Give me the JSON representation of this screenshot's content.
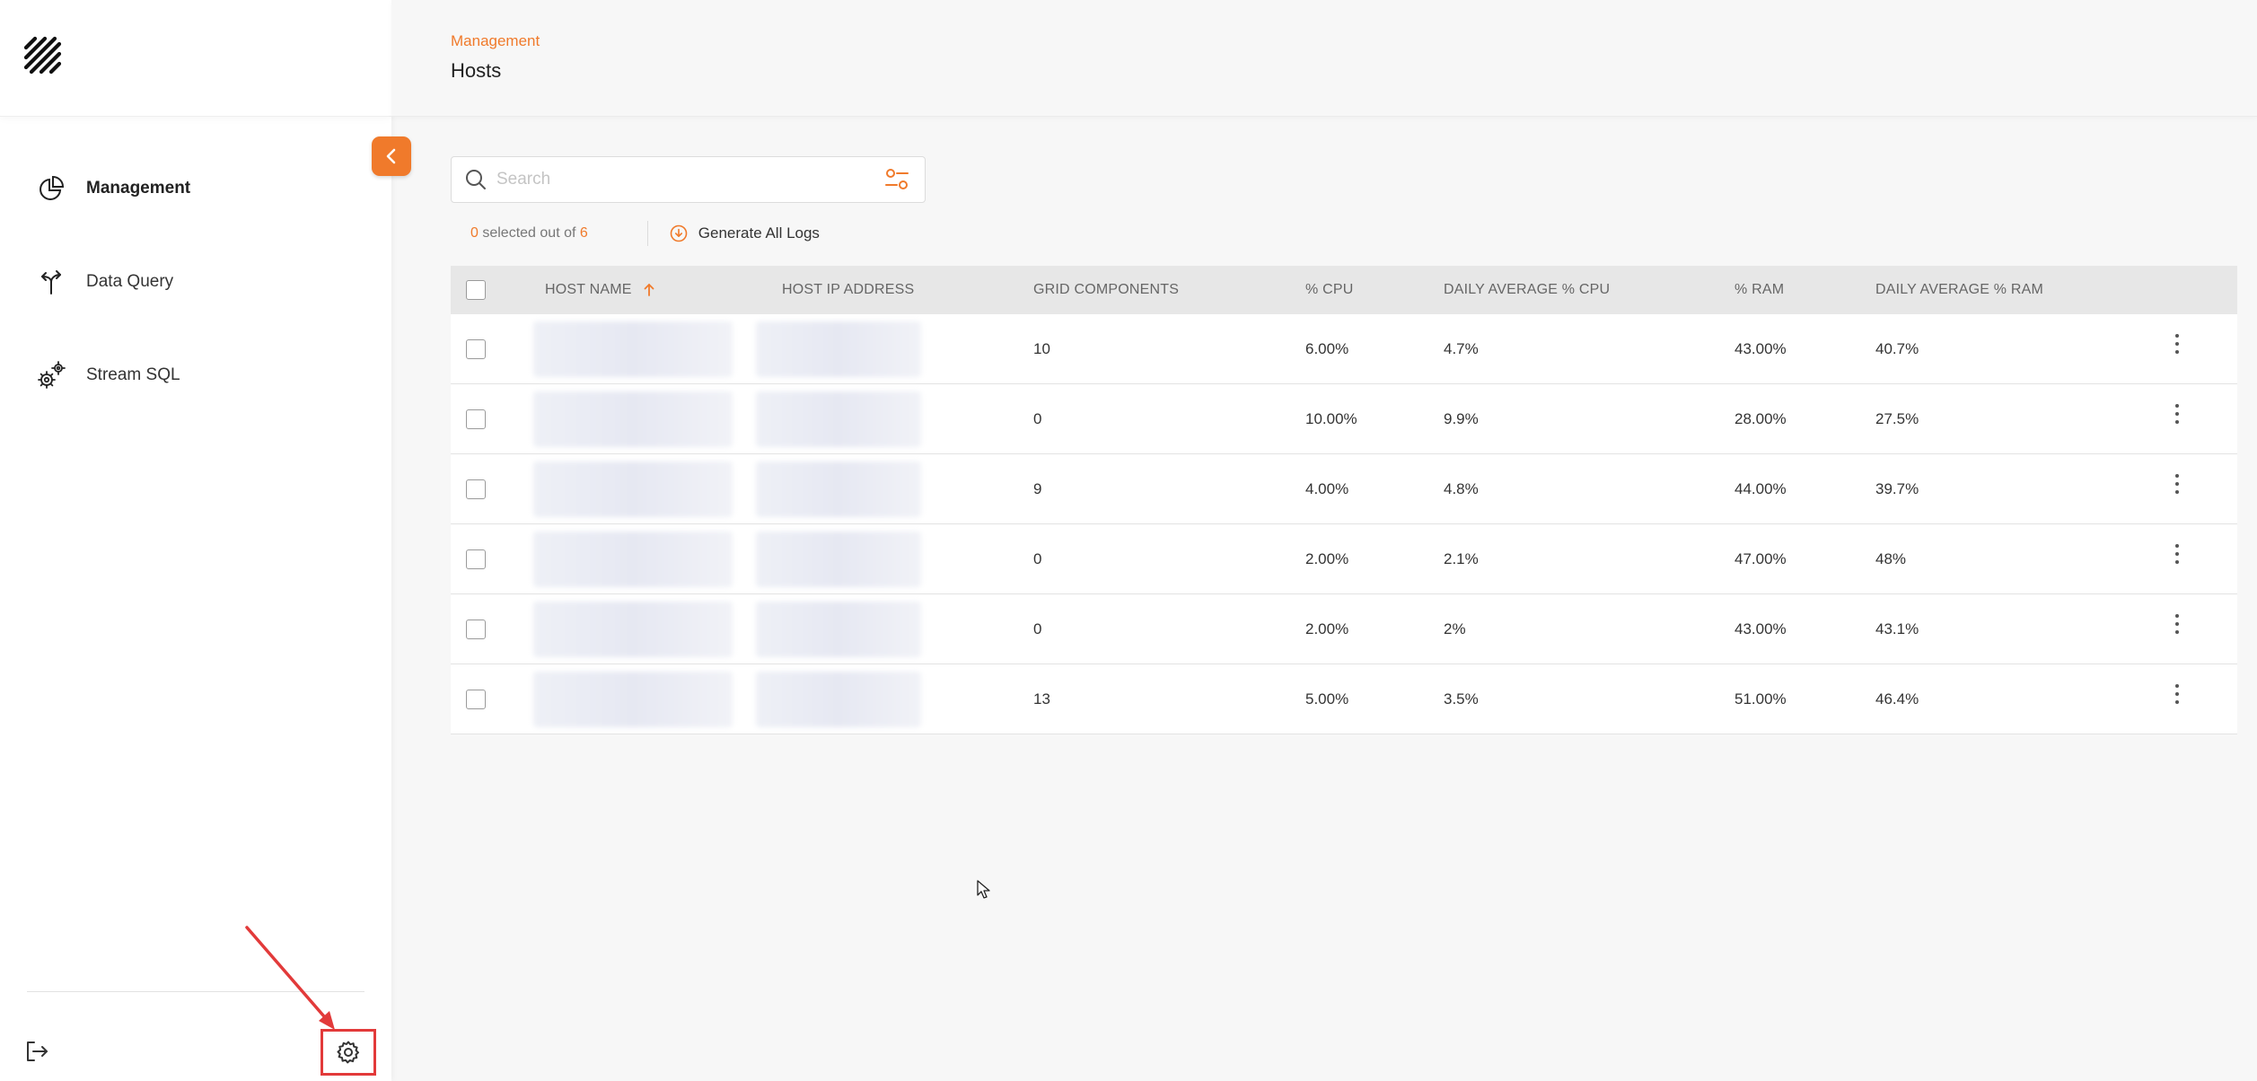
{
  "sidebar": {
    "nav_items": [
      {
        "label": "Management",
        "icon": "pie-chart-icon",
        "active": true
      },
      {
        "label": "Data Query",
        "icon": "split-arrows-icon",
        "active": false
      },
      {
        "label": "Stream SQL",
        "icon": "gears-icon",
        "active": false
      }
    ]
  },
  "header": {
    "breadcrumb": "Management",
    "title": "Hosts"
  },
  "search": {
    "placeholder": "Search",
    "value": ""
  },
  "selection": {
    "selected": "0",
    "middle_text": " selected out of ",
    "total": "6"
  },
  "actions": {
    "generate_logs_label": "Generate All Logs"
  },
  "table": {
    "columns": [
      "HOST NAME",
      "HOST IP ADDRESS",
      "GRID COMPONENTS",
      "% CPU",
      "DAILY AVERAGE % CPU",
      "% RAM",
      "DAILY AVERAGE % RAM"
    ],
    "sorted_column": "HOST NAME",
    "sort_direction": "asc",
    "rows": [
      {
        "grid_components": "10",
        "cpu": "6.00%",
        "avg_cpu": "4.7%",
        "ram": "43.00%",
        "avg_ram": "40.7%"
      },
      {
        "grid_components": "0",
        "cpu": "10.00%",
        "avg_cpu": "9.9%",
        "ram": "28.00%",
        "avg_ram": "27.5%"
      },
      {
        "grid_components": "9",
        "cpu": "4.00%",
        "avg_cpu": "4.8%",
        "ram": "44.00%",
        "avg_ram": "39.7%"
      },
      {
        "grid_components": "0",
        "cpu": "2.00%",
        "avg_cpu": "2.1%",
        "ram": "47.00%",
        "avg_ram": "48%"
      },
      {
        "grid_components": "0",
        "cpu": "2.00%",
        "avg_cpu": "2%",
        "ram": "43.00%",
        "avg_ram": "43.1%"
      },
      {
        "grid_components": "13",
        "cpu": "5.00%",
        "avg_cpu": "3.5%",
        "ram": "51.00%",
        "avg_ram": "46.4%"
      }
    ]
  },
  "colors": {
    "accent": "#f07a2b",
    "annotation": "#e23a3a"
  }
}
